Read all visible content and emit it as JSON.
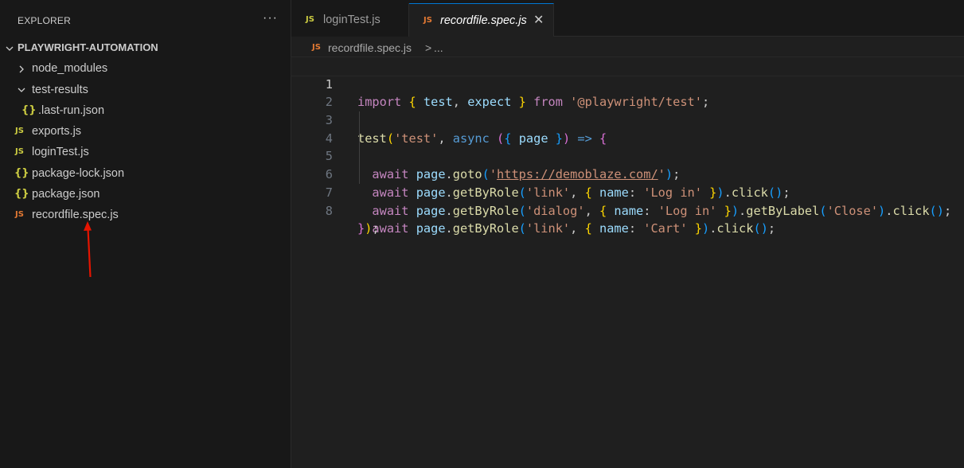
{
  "explorer": {
    "title": "EXPLORER",
    "more_label": "···",
    "root_label": "PLAYWRIGHT-AUTOMATION",
    "items": [
      {
        "label": "node_modules",
        "type": "folder",
        "expanded": false
      },
      {
        "label": "test-results",
        "type": "folder",
        "expanded": true
      },
      {
        "label": ".last-run.json",
        "type": "json",
        "icon_text": "{}"
      },
      {
        "label": "exports.js",
        "type": "js",
        "icon_text": "JS"
      },
      {
        "label": "loginTest.js",
        "type": "js",
        "icon_text": "JS"
      },
      {
        "label": "package-lock.json",
        "type": "json",
        "icon_text": "{}"
      },
      {
        "label": "package.json",
        "type": "json",
        "icon_text": "{}"
      },
      {
        "label": "recordfile.spec.js",
        "type": "js",
        "icon_text": "JS"
      }
    ],
    "annotation_color": "#e51400"
  },
  "tabs": [
    {
      "label": "loginTest.js",
      "icon_text": "JS",
      "active": false
    },
    {
      "label": "recordfile.spec.js",
      "icon_text": "JS",
      "active": true,
      "close_label": "✕"
    }
  ],
  "breadcrumb": {
    "icon_text": "JS",
    "file": "recordfile.spec.js",
    "separator": ">",
    "more": "..."
  },
  "editor": {
    "line_numbers": [
      "1",
      "2",
      "3",
      "4",
      "5",
      "6",
      "7",
      "8"
    ],
    "lines": [
      "import { test, expect } from '@playwright/test';",
      "",
      "test('test', async ({ page }) => {",
      "  await page.goto('https://demoblaze.com/');",
      "  await page.getByRole('link', { name: 'Log in' }).click();",
      "  await page.getByRole('dialog', { name: 'Log in' }).getByLabel('Close').click();",
      "  await page.getByRole('link', { name: 'Cart' }).click();",
      "});"
    ],
    "url_text": "https://demoblaze.com/"
  },
  "colors": {
    "background": "#181818",
    "editor_background": "#1f1f1f",
    "accent": "#0078d4",
    "js_icon_yellow": "#cbcb41",
    "js_icon_orange": "#e37933"
  }
}
